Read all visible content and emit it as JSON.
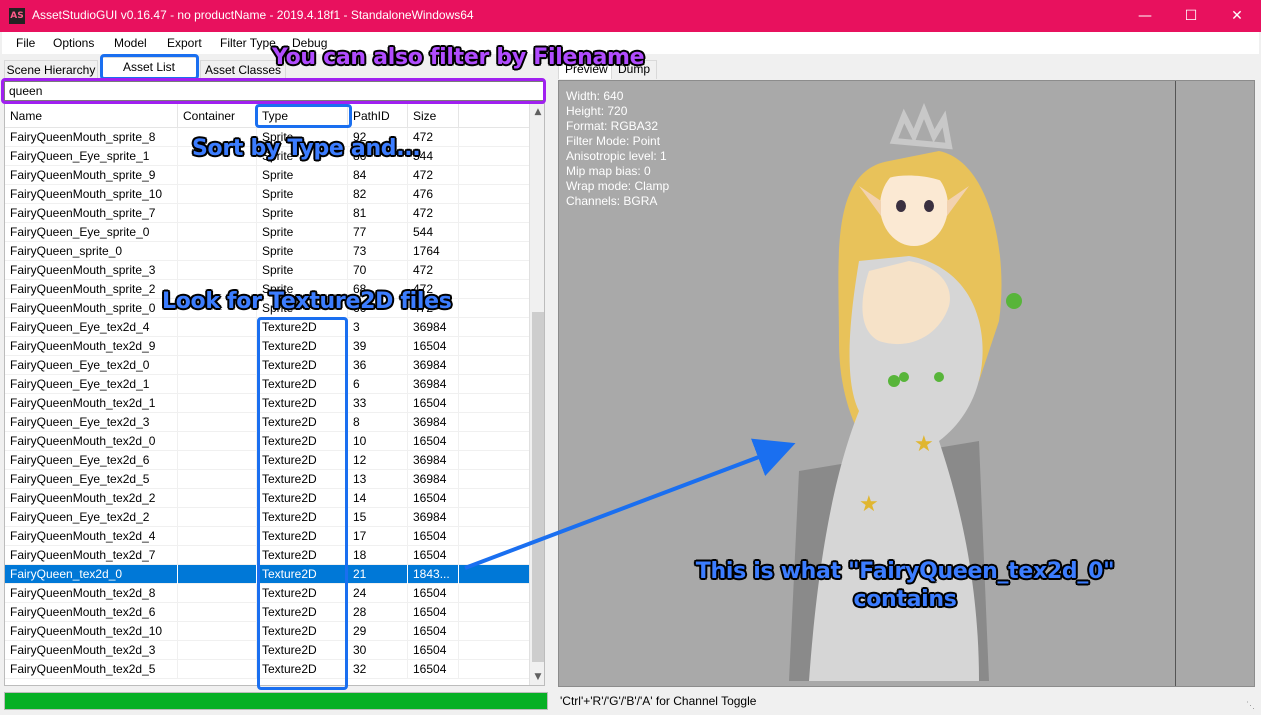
{
  "window": {
    "title": "AssetStudioGUI v0.16.47 - no productName - 2019.4.18f1 - StandaloneWindows64",
    "icon_text": "AS",
    "minimize": "minimize-icon",
    "maximize": "maximize-icon",
    "close": "close-icon"
  },
  "menu": [
    "File",
    "Options",
    "Model",
    "Export",
    "Filter Type",
    "Debug"
  ],
  "left_tabs": [
    "Scene Hierarchy",
    "Asset List",
    "Asset Classes"
  ],
  "search": {
    "value": "queen"
  },
  "columns": [
    "Name",
    "Container",
    "Type",
    "PathID",
    "Size"
  ],
  "rows": [
    {
      "name": "FairyQueenMouth_sprite_8",
      "container": "",
      "type": "Sprite",
      "pathid": "92",
      "size": "472"
    },
    {
      "name": "FairyQueen_Eye_sprite_1",
      "container": "",
      "type": "Sprite",
      "pathid": "86",
      "size": "544"
    },
    {
      "name": "FairyQueenMouth_sprite_9",
      "container": "",
      "type": "Sprite",
      "pathid": "84",
      "size": "472"
    },
    {
      "name": "FairyQueenMouth_sprite_10",
      "container": "",
      "type": "Sprite",
      "pathid": "82",
      "size": "476"
    },
    {
      "name": "FairyQueenMouth_sprite_7",
      "container": "",
      "type": "Sprite",
      "pathid": "81",
      "size": "472"
    },
    {
      "name": "FairyQueen_Eye_sprite_0",
      "container": "",
      "type": "Sprite",
      "pathid": "77",
      "size": "544"
    },
    {
      "name": "FairyQueen_sprite_0",
      "container": "",
      "type": "Sprite",
      "pathid": "73",
      "size": "1764"
    },
    {
      "name": "FairyQueenMouth_sprite_3",
      "container": "",
      "type": "Sprite",
      "pathid": "70",
      "size": "472"
    },
    {
      "name": "FairyQueenMouth_sprite_2",
      "container": "",
      "type": "Sprite",
      "pathid": "68",
      "size": "472"
    },
    {
      "name": "FairyQueenMouth_sprite_0",
      "container": "",
      "type": "Sprite",
      "pathid": "66",
      "size": "472"
    },
    {
      "name": "FairyQueen_Eye_tex2d_4",
      "container": "",
      "type": "Texture2D",
      "pathid": "3",
      "size": "36984"
    },
    {
      "name": "FairyQueenMouth_tex2d_9",
      "container": "",
      "type": "Texture2D",
      "pathid": "39",
      "size": "16504"
    },
    {
      "name": "FairyQueen_Eye_tex2d_0",
      "container": "",
      "type": "Texture2D",
      "pathid": "36",
      "size": "36984"
    },
    {
      "name": "FairyQueen_Eye_tex2d_1",
      "container": "",
      "type": "Texture2D",
      "pathid": "6",
      "size": "36984"
    },
    {
      "name": "FairyQueenMouth_tex2d_1",
      "container": "",
      "type": "Texture2D",
      "pathid": "33",
      "size": "16504"
    },
    {
      "name": "FairyQueen_Eye_tex2d_3",
      "container": "",
      "type": "Texture2D",
      "pathid": "8",
      "size": "36984"
    },
    {
      "name": "FairyQueenMouth_tex2d_0",
      "container": "",
      "type": "Texture2D",
      "pathid": "10",
      "size": "16504"
    },
    {
      "name": "FairyQueen_Eye_tex2d_6",
      "container": "",
      "type": "Texture2D",
      "pathid": "12",
      "size": "36984"
    },
    {
      "name": "FairyQueen_Eye_tex2d_5",
      "container": "",
      "type": "Texture2D",
      "pathid": "13",
      "size": "36984"
    },
    {
      "name": "FairyQueenMouth_tex2d_2",
      "container": "",
      "type": "Texture2D",
      "pathid": "14",
      "size": "16504"
    },
    {
      "name": "FairyQueen_Eye_tex2d_2",
      "container": "",
      "type": "Texture2D",
      "pathid": "15",
      "size": "36984"
    },
    {
      "name": "FairyQueenMouth_tex2d_4",
      "container": "",
      "type": "Texture2D",
      "pathid": "17",
      "size": "16504"
    },
    {
      "name": "FairyQueenMouth_tex2d_7",
      "container": "",
      "type": "Texture2D",
      "pathid": "18",
      "size": "16504"
    },
    {
      "name": "FairyQueen_tex2d_0",
      "container": "",
      "type": "Texture2D",
      "pathid": "21",
      "size": "1843...",
      "selected": true
    },
    {
      "name": "FairyQueenMouth_tex2d_8",
      "container": "",
      "type": "Texture2D",
      "pathid": "24",
      "size": "16504"
    },
    {
      "name": "FairyQueenMouth_tex2d_6",
      "container": "",
      "type": "Texture2D",
      "pathid": "28",
      "size": "16504"
    },
    {
      "name": "FairyQueenMouth_tex2d_10",
      "container": "",
      "type": "Texture2D",
      "pathid": "29",
      "size": "16504"
    },
    {
      "name": "FairyQueenMouth_tex2d_3",
      "container": "",
      "type": "Texture2D",
      "pathid": "30",
      "size": "16504"
    },
    {
      "name": "FairyQueenMouth_tex2d_5",
      "container": "",
      "type": "Texture2D",
      "pathid": "32",
      "size": "16504"
    }
  ],
  "progress": {
    "fraction": 1.0,
    "color": "#06b025"
  },
  "right_tabs": [
    "Preview",
    "Dump"
  ],
  "texture_info": [
    "Width: 640",
    "Height: 720",
    "Format: RGBA32",
    "Filter Mode: Point",
    "Anisotropic level: 1",
    "Mip map bias: 0",
    "Wrap mode: Clamp",
    "Channels: BGRA"
  ],
  "status": "'Ctrl'+'R'/'G'/'B'/'A' for Channel Toggle",
  "annotations": {
    "filter_filename": "You can also filter by Filename",
    "sort_type": "Sort by Type and...",
    "look_texture": "Look for Texture2D files",
    "contains_line1": "This is what \"FairyQueen_tex2d_0\"",
    "contains_line2": "contains"
  },
  "colors": {
    "titlebar": "#e8115e",
    "selection": "#0078d7",
    "annot_purple": "#a020f0",
    "annot_blue": "#1a6ff0"
  }
}
